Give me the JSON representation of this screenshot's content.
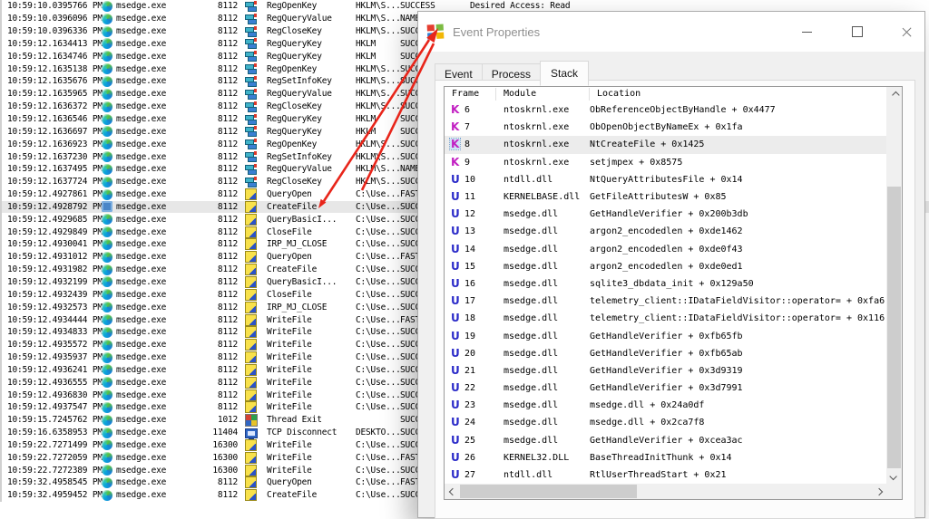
{
  "procmon": {
    "process_name": "msedge.exe",
    "rows": [
      {
        "time": "10:59:10.0395766 PM",
        "process": "msedge.exe",
        "pid": "8112",
        "icon": "registry",
        "operation": "RegOpenKey",
        "path": "HKLM\\S...",
        "result": "SUCCESS",
        "detail": "Desired Access: Read",
        "selected": false
      },
      {
        "time": "10:59:10.0396096 PM",
        "process": "msedge.exe",
        "pid": "8112",
        "icon": "registry",
        "operation": "RegQueryValue",
        "path": "HKLM\\S...",
        "result": "NAME NOT FOUND",
        "detail": "",
        "selected": false
      },
      {
        "time": "10:59:10.0396336 PM",
        "process": "msedge.exe",
        "pid": "8112",
        "icon": "registry",
        "operation": "RegCloseKey",
        "path": "HKLM\\S...",
        "result": "SUCCESS",
        "detail": "",
        "selected": false
      },
      {
        "time": "10:59:12.1634413 PM",
        "process": "msedge.exe",
        "pid": "8112",
        "icon": "registry",
        "operation": "RegQueryKey",
        "path": "HKLM",
        "result": "SUCCESS",
        "detail": "",
        "selected": false
      },
      {
        "time": "10:59:12.1634746 PM",
        "process": "msedge.exe",
        "pid": "8112",
        "icon": "registry",
        "operation": "RegQueryKey",
        "path": "HKLM",
        "result": "SUCCESS",
        "detail": "",
        "selected": false
      },
      {
        "time": "10:59:12.1635138 PM",
        "process": "msedge.exe",
        "pid": "8112",
        "icon": "registry",
        "operation": "RegOpenKey",
        "path": "HKLM\\S...",
        "result": "SUCCESS",
        "detail": "",
        "selected": false
      },
      {
        "time": "10:59:12.1635676 PM",
        "process": "msedge.exe",
        "pid": "8112",
        "icon": "registry",
        "operation": "RegSetInfoKey",
        "path": "HKLM\\S...",
        "result": "SUCCESS",
        "detail": "",
        "selected": false
      },
      {
        "time": "10:59:12.1635965 PM",
        "process": "msedge.exe",
        "pid": "8112",
        "icon": "registry",
        "operation": "RegQueryValue",
        "path": "HKLM\\S...",
        "result": "SUCCESS",
        "detail": "",
        "selected": false
      },
      {
        "time": "10:59:12.1636372 PM",
        "process": "msedge.exe",
        "pid": "8112",
        "icon": "registry",
        "operation": "RegCloseKey",
        "path": "HKLM\\S...",
        "result": "SUCCESS",
        "detail": "",
        "selected": false
      },
      {
        "time": "10:59:12.1636546 PM",
        "process": "msedge.exe",
        "pid": "8112",
        "icon": "registry",
        "operation": "RegQueryKey",
        "path": "HKLM",
        "result": "SUCCESS",
        "detail": "",
        "selected": false
      },
      {
        "time": "10:59:12.1636697 PM",
        "process": "msedge.exe",
        "pid": "8112",
        "icon": "registry",
        "operation": "RegQueryKey",
        "path": "HKLM",
        "result": "SUCCESS",
        "detail": "",
        "selected": false
      },
      {
        "time": "10:59:12.1636923 PM",
        "process": "msedge.exe",
        "pid": "8112",
        "icon": "registry",
        "operation": "RegOpenKey",
        "path": "HKLM\\S...",
        "result": "SUCCESS",
        "detail": "",
        "selected": false
      },
      {
        "time": "10:59:12.1637230 PM",
        "process": "msedge.exe",
        "pid": "8112",
        "icon": "registry",
        "operation": "RegSetInfoKey",
        "path": "HKLM\\S...",
        "result": "SUCCESS",
        "detail": "",
        "selected": false
      },
      {
        "time": "10:59:12.1637495 PM",
        "process": "msedge.exe",
        "pid": "8112",
        "icon": "registry",
        "operation": "RegQueryValue",
        "path": "HKLM\\S...",
        "result": "NAME NOT FOUND",
        "detail": "",
        "selected": false
      },
      {
        "time": "10:59:12.1637724 PM",
        "process": "msedge.exe",
        "pid": "8112",
        "icon": "registry",
        "operation": "RegCloseKey",
        "path": "HKLM\\S...",
        "result": "SUCCESS",
        "detail": "",
        "selected": false
      },
      {
        "time": "10:59:12.4927861 PM",
        "process": "msedge.exe",
        "pid": "8112",
        "icon": "file",
        "operation": "QueryOpen",
        "path": "C:\\Use...",
        "result": "FAST IO DISALLOWED",
        "detail": "",
        "selected": false
      },
      {
        "time": "10:59:12.4928792 PM",
        "process": "msedge.exe",
        "pid": "8112",
        "icon": "file",
        "operation": "CreateFile",
        "path": "C:\\Use...",
        "result": "SUCCESS",
        "detail": "",
        "selected": true
      },
      {
        "time": "10:59:12.4929685 PM",
        "process": "msedge.exe",
        "pid": "8112",
        "icon": "file",
        "operation": "QueryBasicI...",
        "path": "C:\\Use...",
        "result": "SUCCESS",
        "detail": "",
        "selected": false
      },
      {
        "time": "10:59:12.4929849 PM",
        "process": "msedge.exe",
        "pid": "8112",
        "icon": "file",
        "operation": "CloseFile",
        "path": "C:\\Use...",
        "result": "SUCCESS",
        "detail": "",
        "selected": false
      },
      {
        "time": "10:59:12.4930041 PM",
        "process": "msedge.exe",
        "pid": "8112",
        "icon": "file",
        "operation": "IRP_MJ_CLOSE",
        "path": "C:\\Use...",
        "result": "SUCCESS",
        "detail": "",
        "selected": false
      },
      {
        "time": "10:59:12.4931012 PM",
        "process": "msedge.exe",
        "pid": "8112",
        "icon": "file",
        "operation": "QueryOpen",
        "path": "C:\\Use...",
        "result": "FAST IO DISALLOWED",
        "detail": "",
        "selected": false
      },
      {
        "time": "10:59:12.4931982 PM",
        "process": "msedge.exe",
        "pid": "8112",
        "icon": "file",
        "operation": "CreateFile",
        "path": "C:\\Use...",
        "result": "SUCCESS",
        "detail": "",
        "selected": false
      },
      {
        "time": "10:59:12.4932199 PM",
        "process": "msedge.exe",
        "pid": "8112",
        "icon": "file",
        "operation": "QueryBasicI...",
        "path": "C:\\Use...",
        "result": "SUCCESS",
        "detail": "",
        "selected": false
      },
      {
        "time": "10:59:12.4932439 PM",
        "process": "msedge.exe",
        "pid": "8112",
        "icon": "file",
        "operation": "CloseFile",
        "path": "C:\\Use...",
        "result": "SUCCESS",
        "detail": "",
        "selected": false
      },
      {
        "time": "10:59:12.4932573 PM",
        "process": "msedge.exe",
        "pid": "8112",
        "icon": "file",
        "operation": "IRP_MJ_CLOSE",
        "path": "C:\\Use...",
        "result": "SUCCESS",
        "detail": "",
        "selected": false
      },
      {
        "time": "10:59:12.4934444 PM",
        "process": "msedge.exe",
        "pid": "8112",
        "icon": "file",
        "operation": "WriteFile",
        "path": "C:\\Use...",
        "result": "FAST IO DISALLOWED",
        "detail": "",
        "selected": false
      },
      {
        "time": "10:59:12.4934833 PM",
        "process": "msedge.exe",
        "pid": "8112",
        "icon": "file",
        "operation": "WriteFile",
        "path": "C:\\Use...",
        "result": "SUCCESS",
        "detail": "",
        "selected": false
      },
      {
        "time": "10:59:12.4935572 PM",
        "process": "msedge.exe",
        "pid": "8112",
        "icon": "file",
        "operation": "WriteFile",
        "path": "C:\\Use...",
        "result": "SUCCESS",
        "detail": "",
        "selected": false
      },
      {
        "time": "10:59:12.4935937 PM",
        "process": "msedge.exe",
        "pid": "8112",
        "icon": "file",
        "operation": "WriteFile",
        "path": "C:\\Use...",
        "result": "SUCCESS",
        "detail": "",
        "selected": false
      },
      {
        "time": "10:59:12.4936241 PM",
        "process": "msedge.exe",
        "pid": "8112",
        "icon": "file",
        "operation": "WriteFile",
        "path": "C:\\Use...",
        "result": "SUCCESS",
        "detail": "",
        "selected": false
      },
      {
        "time": "10:59:12.4936555 PM",
        "process": "msedge.exe",
        "pid": "8112",
        "icon": "file",
        "operation": "WriteFile",
        "path": "C:\\Use...",
        "result": "SUCCESS",
        "detail": "",
        "selected": false
      },
      {
        "time": "10:59:12.4936830 PM",
        "process": "msedge.exe",
        "pid": "8112",
        "icon": "file",
        "operation": "WriteFile",
        "path": "C:\\Use...",
        "result": "SUCCESS",
        "detail": "",
        "selected": false
      },
      {
        "time": "10:59:12.4937547 PM",
        "process": "msedge.exe",
        "pid": "8112",
        "icon": "file",
        "operation": "WriteFile",
        "path": "C:\\Use...",
        "result": "SUCCESS",
        "detail": "",
        "selected": false
      },
      {
        "time": "10:59:15.7245762 PM",
        "process": "msedge.exe",
        "pid": "1012",
        "icon": "thread",
        "operation": "Thread Exit",
        "path": "",
        "result": "SUCCESS",
        "detail": "",
        "selected": false
      },
      {
        "time": "10:59:16.6358953 PM",
        "process": "msedge.exe",
        "pid": "11404",
        "icon": "network",
        "operation": "TCP Disconnect",
        "path": "DESKTO...",
        "result": "SUCCESS",
        "detail": "",
        "selected": false
      },
      {
        "time": "10:59:22.7271499 PM",
        "process": "msedge.exe",
        "pid": "16300",
        "icon": "file",
        "operation": "WriteFile",
        "path": "C:\\Use...",
        "result": "SUCCESS",
        "detail": "",
        "selected": false
      },
      {
        "time": "10:59:22.7272059 PM",
        "process": "msedge.exe",
        "pid": "16300",
        "icon": "file",
        "operation": "WriteFile",
        "path": "C:\\Use...",
        "result": "FAST IO DISALLOWED",
        "detail": "",
        "selected": false
      },
      {
        "time": "10:59:22.7272389 PM",
        "process": "msedge.exe",
        "pid": "16300",
        "icon": "file",
        "operation": "WriteFile",
        "path": "C:\\Use...",
        "result": "SUCCESS",
        "detail": "",
        "selected": false
      },
      {
        "time": "10:59:32.4958545 PM",
        "process": "msedge.exe",
        "pid": "8112",
        "icon": "file",
        "operation": "QueryOpen",
        "path": "C:\\Use...",
        "result": "FAST IO DISALLOWED",
        "detail": "",
        "selected": false
      },
      {
        "time": "10:59:32.4959452 PM",
        "process": "msedge.exe",
        "pid": "8112",
        "icon": "file",
        "operation": "CreateFile",
        "path": "C:\\Use...",
        "result": "SUCCESS",
        "detail": "",
        "selected": false
      }
    ]
  },
  "dialog": {
    "title": "Event Properties",
    "tabs": [
      {
        "label": "Event",
        "active": false
      },
      {
        "label": "Process",
        "active": false
      },
      {
        "label": "Stack",
        "active": true
      }
    ],
    "stack": {
      "columns": [
        "Frame",
        "Module",
        "Location"
      ],
      "frames": [
        {
          "ring": "K",
          "frame": "6",
          "module": "ntoskrnl.exe",
          "location": "ObReferenceObjectByHandle + 0x4477",
          "selected": false
        },
        {
          "ring": "K",
          "frame": "7",
          "module": "ntoskrnl.exe",
          "location": "ObOpenObjectByNameEx + 0x1fa",
          "selected": false
        },
        {
          "ring": "K",
          "frame": "8",
          "module": "ntoskrnl.exe",
          "location": "NtCreateFile + 0x1425",
          "selected": true
        },
        {
          "ring": "K",
          "frame": "9",
          "module": "ntoskrnl.exe",
          "location": "setjmpex + 0x8575",
          "selected": false
        },
        {
          "ring": "U",
          "frame": "10",
          "module": "ntdll.dll",
          "location": "NtQueryAttributesFile + 0x14",
          "selected": false
        },
        {
          "ring": "U",
          "frame": "11",
          "module": "KERNELBASE.dll",
          "location": "GetFileAttributesW + 0x85",
          "selected": false
        },
        {
          "ring": "U",
          "frame": "12",
          "module": "msedge.dll",
          "location": "GetHandleVerifier + 0x200b3db",
          "selected": false
        },
        {
          "ring": "U",
          "frame": "13",
          "module": "msedge.dll",
          "location": "argon2_encodedlen + 0xde1462",
          "selected": false
        },
        {
          "ring": "U",
          "frame": "14",
          "module": "msedge.dll",
          "location": "argon2_encodedlen + 0xde0f43",
          "selected": false
        },
        {
          "ring": "U",
          "frame": "15",
          "module": "msedge.dll",
          "location": "argon2_encodedlen + 0xde0ed1",
          "selected": false
        },
        {
          "ring": "U",
          "frame": "16",
          "module": "msedge.dll",
          "location": "sqlite3_dbdata_init + 0x129a50",
          "selected": false
        },
        {
          "ring": "U",
          "frame": "17",
          "module": "msedge.dll",
          "location": "telemetry_client::IDataFieldVisitor::operator= + 0xfa6",
          "selected": false
        },
        {
          "ring": "U",
          "frame": "18",
          "module": "msedge.dll",
          "location": "telemetry_client::IDataFieldVisitor::operator= + 0x116",
          "selected": false
        },
        {
          "ring": "U",
          "frame": "19",
          "module": "msedge.dll",
          "location": "GetHandleVerifier + 0xfb65fb",
          "selected": false
        },
        {
          "ring": "U",
          "frame": "20",
          "module": "msedge.dll",
          "location": "GetHandleVerifier + 0xfb65ab",
          "selected": false
        },
        {
          "ring": "U",
          "frame": "21",
          "module": "msedge.dll",
          "location": "GetHandleVerifier + 0x3d9319",
          "selected": false
        },
        {
          "ring": "U",
          "frame": "22",
          "module": "msedge.dll",
          "location": "GetHandleVerifier + 0x3d7991",
          "selected": false
        },
        {
          "ring": "U",
          "frame": "23",
          "module": "msedge.dll",
          "location": "msedge.dll + 0x24a0df",
          "selected": false
        },
        {
          "ring": "U",
          "frame": "24",
          "module": "msedge.dll",
          "location": "msedge.dll + 0x2ca7f8",
          "selected": false
        },
        {
          "ring": "U",
          "frame": "25",
          "module": "msedge.dll",
          "location": "GetHandleVerifier + 0xcea3ac",
          "selected": false
        },
        {
          "ring": "U",
          "frame": "26",
          "module": "KERNEL32.DLL",
          "location": "BaseThreadInitThunk + 0x14",
          "selected": false
        },
        {
          "ring": "U",
          "frame": "27",
          "module": "ntdll.dll",
          "location": "RtlUserThreadStart + 0x21",
          "selected": false
        }
      ]
    }
  },
  "colors": {
    "annotation_arrow": "#e8251a",
    "kernel_frame": "#c220c2",
    "user_frame": "#2929c8",
    "selection_bg": "#ececec"
  }
}
